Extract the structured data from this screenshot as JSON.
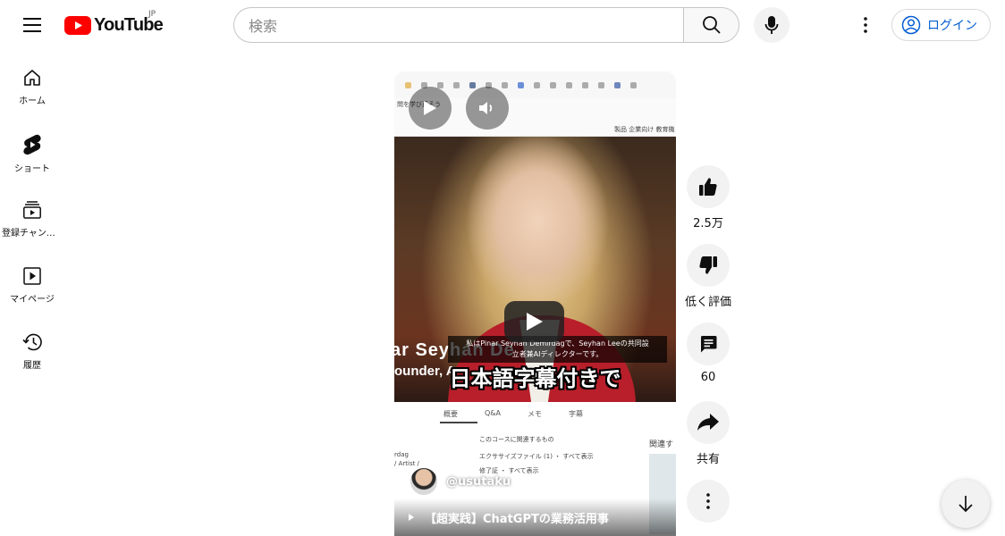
{
  "header": {
    "logo_text": "YouTube",
    "region": "JP",
    "search_placeholder": "検索",
    "login_label": "ログイン"
  },
  "sidebar": {
    "items": [
      {
        "label": "ホーム",
        "icon": "home-icon"
      },
      {
        "label": "ショート",
        "icon": "shorts-icon"
      },
      {
        "label": "登録チャンネル",
        "icon": "subscriptions-icon"
      },
      {
        "label": "マイページ",
        "icon": "library-icon"
      },
      {
        "label": "履歴",
        "icon": "history-icon"
      }
    ]
  },
  "video": {
    "subtitle_line1": "私はPinar Seyhan Demirdagで、Seyhan Leeの共同設",
    "subtitle_line2": "立者兼AIディレクターです。",
    "caption": "日本語字幕付きで",
    "name_overlay": "ar Seyhan De",
    "role_overlay": "ounder, A",
    "page_text_top": "問を学び直そう",
    "page_links": "製品  企業向け  教育機",
    "tabs": [
      "概要",
      "Q&A",
      "メモ",
      "字幕"
    ],
    "related_heading": "このコースに関連するもの",
    "related_item1": "エクササイズファイル (1) ・ すべて表示",
    "related_item2": "修了証 ・ すべて表示",
    "side_text1": "rdag",
    "side_text2": "/ Artist /",
    "related_right": "関連す",
    "channel_name": "@usutaku",
    "title": "【超実践】ChatGPTの業務活用事"
  },
  "actions": {
    "like_count": "2.5万",
    "dislike_label": "低く評価",
    "comment_count": "60",
    "share_label": "共有"
  },
  "colors": {
    "brand_red": "#ff0000",
    "link_blue": "#065fd4"
  }
}
